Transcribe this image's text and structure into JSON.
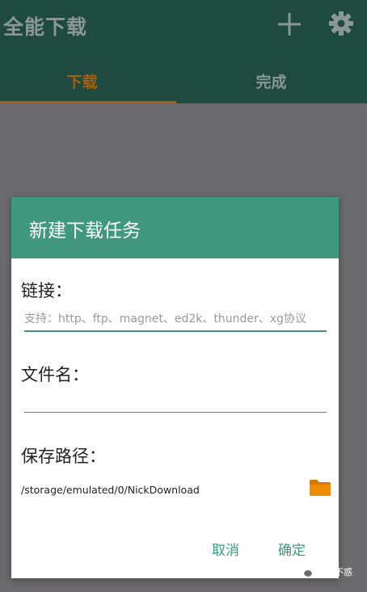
{
  "app": {
    "title": "全能下载",
    "tabs": [
      {
        "label": "下载"
      },
      {
        "label": "完成"
      }
    ]
  },
  "icons": {
    "add": "plus-icon",
    "settings": "gear-icon",
    "folder": "folder-icon",
    "wechat": "wechat-icon"
  },
  "dialog": {
    "title": "新建下载任务",
    "url_label": "链接：",
    "url_placeholder": "支持：http、ftp、magnet、ed2k、thunder、xg协议",
    "url_value": "",
    "filename_label": "文件名：",
    "filename_value": "",
    "path_label": "保存路径：",
    "path_value": "/storage/emulated/0/NickDownload",
    "cancel_label": "取消",
    "ok_label": "确定"
  },
  "watermark": {
    "text": "苏生不惑"
  },
  "colors": {
    "accent": "#41987d",
    "appbar_dimmed": "#1f4a40",
    "tab_active": "#a5610b",
    "folder": "#f08c00"
  }
}
